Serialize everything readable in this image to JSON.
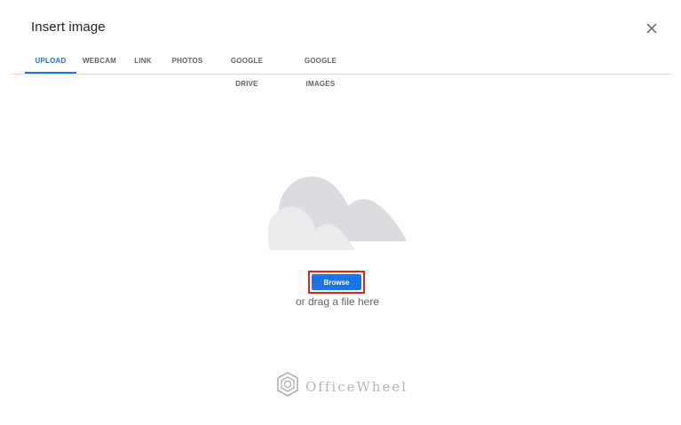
{
  "dialog": {
    "title": "Insert image",
    "close_icon": "close-icon"
  },
  "tabs": [
    {
      "label": "UPLOAD",
      "active": true
    },
    {
      "label": "WEBCAM",
      "active": false
    },
    {
      "label": "LINK",
      "active": false
    },
    {
      "label": "PHOTOS",
      "active": false
    },
    {
      "label": "GOOGLE DRIVE",
      "active": false
    },
    {
      "label": "GOOGLE IMAGES",
      "active": false
    }
  ],
  "upload": {
    "illustration_icon": "cloud-icon",
    "browse_label": "Browse",
    "drag_hint": "or drag a file here"
  },
  "watermark": {
    "text": "OfficeWheel",
    "icon": "officewheel-logo-icon"
  },
  "colors": {
    "accent": "#1a73e8",
    "highlight_border": "#e1241b"
  }
}
